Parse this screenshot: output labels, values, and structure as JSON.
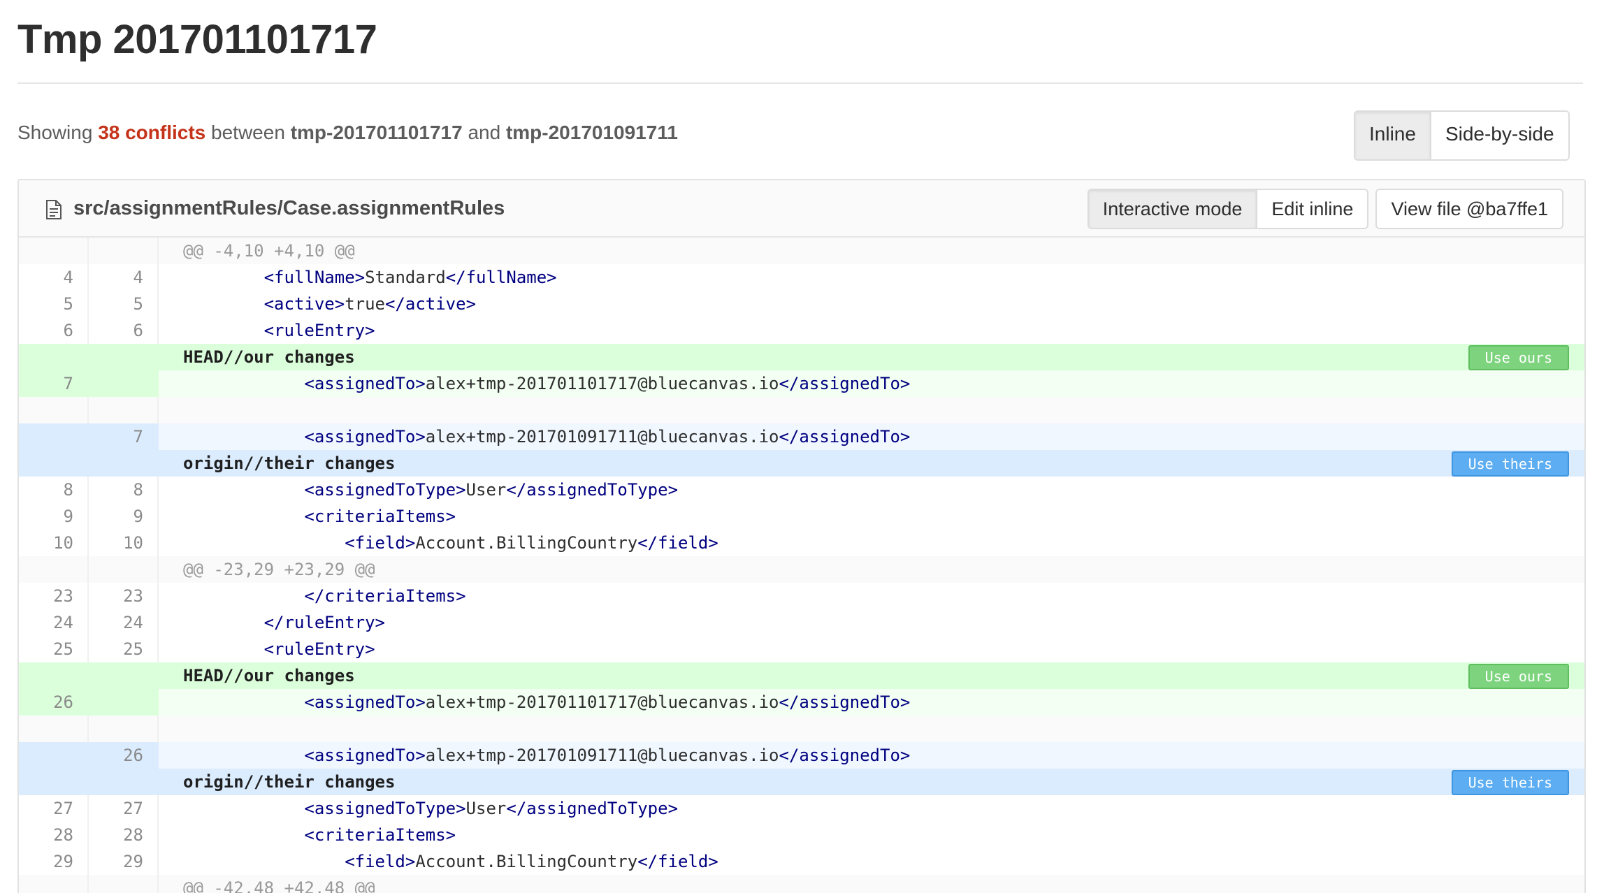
{
  "page": {
    "title": "Tmp 201701101717",
    "summary": {
      "prefix": "Showing",
      "conflicts": "38 conflicts",
      "between": "between",
      "source_branch": "tmp-201701101717",
      "and": "and",
      "target_branch": "tmp-201701091711"
    },
    "view_modes": [
      "Inline",
      "Side-by-side"
    ],
    "active_view_mode": "Inline"
  },
  "file": {
    "icon": "file-text-icon",
    "path": "src/assignmentRules/Case.assignmentRules",
    "actions": {
      "interactive_mode": "Interactive mode",
      "edit_inline": "Edit inline",
      "view_file": "View file @ba7ffe1"
    },
    "active_action": "Interactive mode"
  },
  "diff": {
    "buttons": {
      "use_ours": "Use ours",
      "use_theirs": "Use theirs"
    },
    "rows": [
      {
        "type": "hunk",
        "old": "",
        "new": "",
        "text": "@@ -4,10 +4,10 @@"
      },
      {
        "type": "context",
        "old": "4",
        "new": "4",
        "text": "        <fullName>Standard</fullName>"
      },
      {
        "type": "context",
        "old": "5",
        "new": "5",
        "text": "        <active>true</active>"
      },
      {
        "type": "context",
        "old": "6",
        "new": "6",
        "text": "        <ruleEntry>"
      },
      {
        "type": "our-head",
        "old": "",
        "new": "",
        "text": "HEAD//our changes"
      },
      {
        "type": "our-line",
        "old": "7",
        "new": "",
        "text": "            <assignedTo>alex+tmp-201701101717@bluecanvas.io</assignedTo>"
      },
      {
        "type": "empty",
        "old": "",
        "new": "",
        "text": ""
      },
      {
        "type": "their-line",
        "old": "",
        "new": "7",
        "text": "            <assignedTo>alex+tmp-201701091711@bluecanvas.io</assignedTo>"
      },
      {
        "type": "their-head",
        "old": "",
        "new": "",
        "text": "origin//their changes"
      },
      {
        "type": "context",
        "old": "8",
        "new": "8",
        "text": "            <assignedToType>User</assignedToType>"
      },
      {
        "type": "context",
        "old": "9",
        "new": "9",
        "text": "            <criteriaItems>"
      },
      {
        "type": "context",
        "old": "10",
        "new": "10",
        "text": "                <field>Account.BillingCountry</field>"
      },
      {
        "type": "hunk",
        "old": "",
        "new": "",
        "text": "@@ -23,29 +23,29 @@"
      },
      {
        "type": "context",
        "old": "23",
        "new": "23",
        "text": "            </criteriaItems>"
      },
      {
        "type": "context",
        "old": "24",
        "new": "24",
        "text": "        </ruleEntry>"
      },
      {
        "type": "context",
        "old": "25",
        "new": "25",
        "text": "        <ruleEntry>"
      },
      {
        "type": "our-head",
        "old": "",
        "new": "",
        "text": "HEAD//our changes"
      },
      {
        "type": "our-line",
        "old": "26",
        "new": "",
        "text": "            <assignedTo>alex+tmp-201701101717@bluecanvas.io</assignedTo>"
      },
      {
        "type": "empty",
        "old": "",
        "new": "",
        "text": ""
      },
      {
        "type": "their-line",
        "old": "",
        "new": "26",
        "text": "            <assignedTo>alex+tmp-201701091711@bluecanvas.io</assignedTo>"
      },
      {
        "type": "their-head",
        "old": "",
        "new": "",
        "text": "origin//their changes"
      },
      {
        "type": "context",
        "old": "27",
        "new": "27",
        "text": "            <assignedToType>User</assignedToType>"
      },
      {
        "type": "context",
        "old": "28",
        "new": "28",
        "text": "            <criteriaItems>"
      },
      {
        "type": "context",
        "old": "29",
        "new": "29",
        "text": "                <field>Account.BillingCountry</field>"
      },
      {
        "type": "hunk",
        "old": "",
        "new": "",
        "text": "@@ -42,48 +42,48 @@"
      }
    ]
  },
  "colors": {
    "conflict_count": "#c4331a",
    "ours_header_bg": "#dbffdb",
    "ours_line_bg": "#f2fff2",
    "theirs_header_bg": "#dbecff",
    "theirs_line_bg": "#f0f7ff",
    "use_ours_button": "#7ed47e",
    "use_theirs_button": "#5cadf2",
    "xml_tag": "#000080"
  }
}
